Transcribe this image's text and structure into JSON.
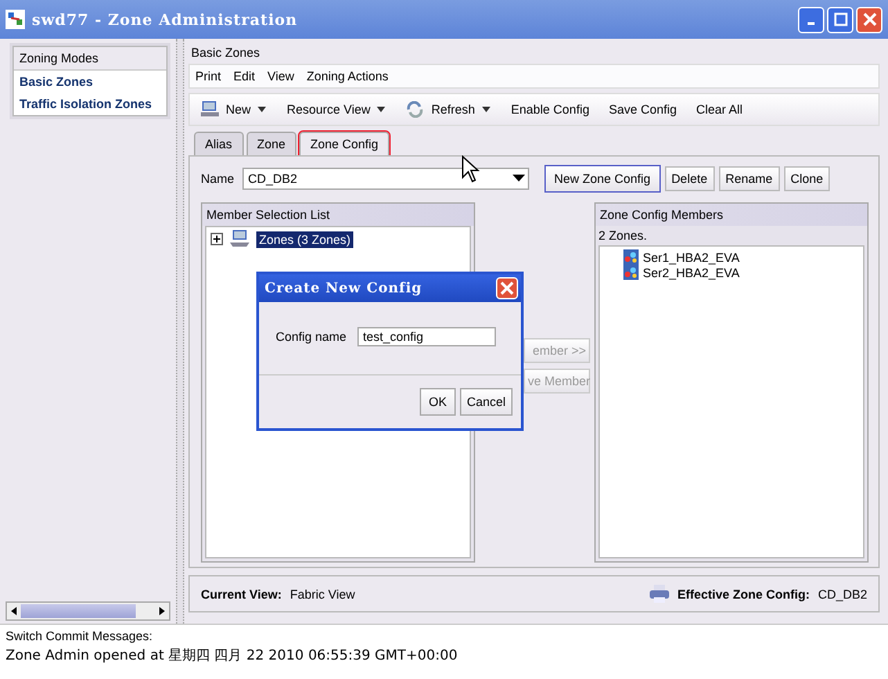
{
  "window": {
    "title": "swd77 - Zone Administration"
  },
  "zoning_modes": {
    "title": "Zoning Modes",
    "items": [
      "Basic Zones",
      "Traffic Isolation Zones"
    ]
  },
  "panel_title": "Basic Zones",
  "menu": [
    "Print",
    "Edit",
    "View",
    "Zoning Actions"
  ],
  "toolbar": [
    {
      "label": "New",
      "kind": "new",
      "dropdown": true
    },
    {
      "label": "Resource View",
      "kind": "plain",
      "dropdown": true
    },
    {
      "label": "Refresh",
      "kind": "refresh",
      "dropdown": true
    },
    {
      "label": "Enable Config",
      "kind": "plain",
      "dropdown": false
    },
    {
      "label": "Save Config",
      "kind": "plain",
      "dropdown": false
    },
    {
      "label": "Clear All",
      "kind": "plain",
      "dropdown": false
    }
  ],
  "tabs": [
    {
      "label": "Alias",
      "selected": false
    },
    {
      "label": "Zone",
      "selected": false
    },
    {
      "label": "Zone Config",
      "selected": true
    }
  ],
  "name_field": {
    "label": "Name",
    "value": "CD_DB2"
  },
  "config_buttons": [
    {
      "label": "New Zone Config",
      "focused": true
    },
    {
      "label": "Delete",
      "focused": false
    },
    {
      "label": "Rename",
      "focused": false
    },
    {
      "label": "Clone",
      "focused": false
    }
  ],
  "member_list": {
    "title": "Member Selection List",
    "tree": [
      {
        "label": "Zones (3 Zones)",
        "expanded": false,
        "selected": true
      }
    ]
  },
  "move_buttons": [
    {
      "label": "ember >>",
      "disabled": true
    },
    {
      "label": "ve Member",
      "disabled": true
    }
  ],
  "config_members": {
    "title": "Zone Config Members",
    "count": "2 Zones.",
    "items": [
      "Ser1_HBA2_EVA",
      "Ser2_HBA2_EVA"
    ]
  },
  "status": {
    "current_view_label": "Current View:",
    "current_view": "Fabric View",
    "effective_label": "Effective Zone Config:",
    "effective": "CD_DB2"
  },
  "messages": {
    "title": "Switch Commit Messages:",
    "lines": [
      "Zone Admin opened at 星期四 四月 22 2010 06:55:39 GMT+00:00"
    ]
  },
  "dialog": {
    "title": "Create New Config",
    "field_label": "Config name",
    "value": "test_config",
    "buttons": [
      "OK",
      "Cancel"
    ]
  }
}
